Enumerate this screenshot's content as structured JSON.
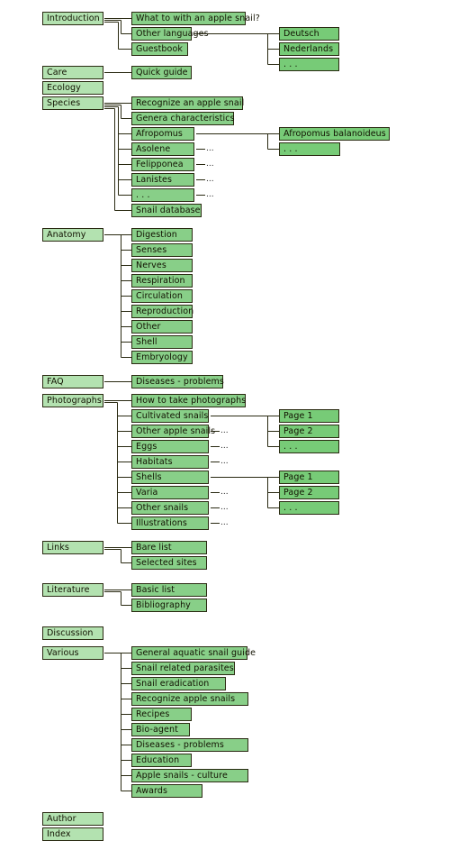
{
  "colors": {
    "level1": "#b3e2b0",
    "level2": "#88cf88",
    "level3": "#77cb77",
    "line": "#2a2a12"
  },
  "more_marker": "...",
  "sections": [
    {
      "label": "Introduction",
      "children": [
        {
          "label": "What to with an apple snail?"
        },
        {
          "label": "Other languages",
          "children": [
            {
              "label": "Deutsch"
            },
            {
              "label": "Nederlands"
            },
            {
              "label": ". . ."
            }
          ]
        },
        {
          "label": "Guestbook"
        }
      ]
    },
    {
      "label": "Care",
      "children": [
        {
          "label": "Quick guide"
        }
      ]
    },
    {
      "label": "Ecology"
    },
    {
      "label": "Species",
      "children": [
        {
          "label": "Recognize an apple snail"
        },
        {
          "label": "Genera characteristics"
        },
        {
          "label": "Afropomus",
          "children": [
            {
              "label": "Afropomus balanoideus"
            },
            {
              "label": ". . ."
            }
          ]
        },
        {
          "label": "Asolene",
          "more": true
        },
        {
          "label": "Felipponea",
          "more": true
        },
        {
          "label": "Lanistes",
          "more": true
        },
        {
          "label": ". . .",
          "more": true
        },
        {
          "label": "Snail database"
        }
      ]
    },
    {
      "label": "Anatomy",
      "children": [
        {
          "label": "Digestion"
        },
        {
          "label": "Senses"
        },
        {
          "label": "Nerves"
        },
        {
          "label": "Respiration"
        },
        {
          "label": "Circulation"
        },
        {
          "label": "Reproduction"
        },
        {
          "label": "Other"
        },
        {
          "label": "Shell"
        },
        {
          "label": "Embryology"
        }
      ]
    },
    {
      "label": "FAQ",
      "children": [
        {
          "label": "Diseases - problems"
        }
      ]
    },
    {
      "label": "Photographs",
      "children": [
        {
          "label": "How to take photographs"
        },
        {
          "label": "Cultivated snails",
          "children": [
            {
              "label": "Page 1"
            },
            {
              "label": "Page 2"
            },
            {
              "label": ". . ."
            }
          ]
        },
        {
          "label": "Other apple snails",
          "more": true
        },
        {
          "label": "Eggs",
          "more": true
        },
        {
          "label": "Habitats",
          "more": true
        },
        {
          "label": "Shells",
          "children": [
            {
              "label": "Page 1"
            },
            {
              "label": "Page 2"
            },
            {
              "label": ". . ."
            }
          ]
        },
        {
          "label": "Varia",
          "more": true
        },
        {
          "label": "Other snails",
          "more": true
        },
        {
          "label": "Illustrations",
          "more": true
        }
      ]
    },
    {
      "label": "Links",
      "children": [
        {
          "label": "Bare list"
        },
        {
          "label": "Selected sites"
        }
      ]
    },
    {
      "label": "Literature",
      "children": [
        {
          "label": "Basic list"
        },
        {
          "label": "Bibliography"
        }
      ]
    },
    {
      "label": "Discussion"
    },
    {
      "label": "Various",
      "children": [
        {
          "label": "General aquatic snail guide"
        },
        {
          "label": "Snail related parasites"
        },
        {
          "label": "Snail eradication"
        },
        {
          "label": "Recognize apple snails"
        },
        {
          "label": "Recipes"
        },
        {
          "label": "Bio-agent"
        },
        {
          "label": "Diseases - problems"
        },
        {
          "label": "Education"
        },
        {
          "label": "Apple snails - culture"
        },
        {
          "label": "Awards"
        }
      ]
    },
    {
      "label": "Author"
    },
    {
      "label": "Index"
    }
  ]
}
